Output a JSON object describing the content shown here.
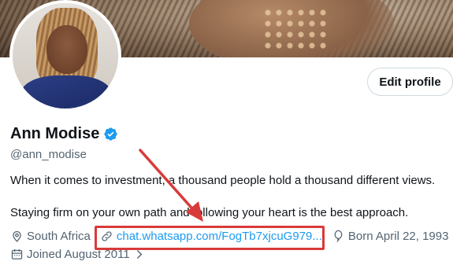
{
  "profile": {
    "name": "Ann Modise",
    "handle": "@ann_modise",
    "bio_line1": "When it comes to investment, a thousand people hold a thousand different views.",
    "bio_line2": "Staying firm on your own path and following your heart is the best approach.",
    "location": "South Africa",
    "website": "chat.whatsapp.com/FogTb7xjcuG979...",
    "born": "Born April 22, 1993",
    "joined": "Joined August 2011",
    "verified": true
  },
  "actions": {
    "edit_profile_label": "Edit profile"
  },
  "colors": {
    "accent": "#1d9bf0",
    "secondary_text": "#536471",
    "annotation": "#d93a3a"
  },
  "icons": {
    "verified": "verified-badge-icon",
    "location": "location-pin-icon",
    "link": "link-icon",
    "born": "balloon-icon",
    "joined": "calendar-icon",
    "joined_chevron": "chevron-right-icon"
  }
}
